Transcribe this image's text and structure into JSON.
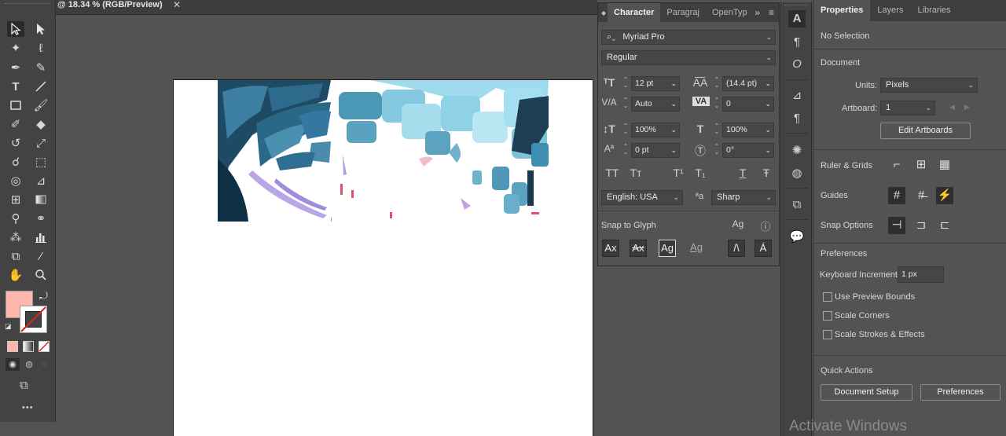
{
  "document": {
    "tab_title": "@ 18.34 % (RGB/Preview)",
    "close_glyph": "✕"
  },
  "toolbar": {
    "tools": [
      "selection-tool",
      "direct-selection-tool",
      "magic-wand-tool",
      "lasso-tool",
      "pen-tool",
      "curvature-tool",
      "type-tool",
      "line-tool",
      "rectangle-tool",
      "paintbrush-tool",
      "shaper-tool",
      "eraser-tool",
      "rotate-tool",
      "scale-tool",
      "warp-tool",
      "free-transform-tool",
      "shape-builder-tool",
      "perspective-grid-tool",
      "mesh-tool",
      "gradient-tool",
      "eyedropper-tool",
      "blend-tool",
      "symbol-sprayer-tool",
      "column-graph-tool",
      "artboard-tool",
      "slice-tool",
      "hand-tool",
      "zoom-tool"
    ],
    "fill_color": "#ffb6ad",
    "more_glyph": "•••"
  },
  "character_panel": {
    "tabs": [
      "Character",
      "Paragraph",
      "OpenType"
    ],
    "tab_labels_visible": [
      "Character",
      "Paragraj",
      "OpenTyp"
    ],
    "font_family": "Myriad Pro",
    "font_style": "Regular",
    "font_size": "12 pt",
    "leading": "(14.4 pt)",
    "kerning": "Auto",
    "tracking": "0",
    "vertical_scale": "100%",
    "horizontal_scale": "100%",
    "baseline_shift": "0 pt",
    "rotation": "0°",
    "language": "English: USA",
    "antialias": "Sharp",
    "snap_to_glyph_label": "Snap to Glyph",
    "text_style_buttons": [
      "TT",
      "Tт",
      "T¹",
      "T₁",
      "T",
      "Ŧ"
    ],
    "aa_glyph": "ªa"
  },
  "properties_panel": {
    "tabs": [
      "Properties",
      "Layers",
      "Libraries"
    ],
    "selection": "No Selection",
    "document_heading": "Document",
    "units_label": "Units:",
    "units_value": "Pixels",
    "artboard_label": "Artboard:",
    "artboard_value": "1",
    "edit_artboards": "Edit Artboards",
    "ruler_grids": "Ruler & Grids",
    "guides": "Guides",
    "snap_options": "Snap Options",
    "preferences_heading": "Preferences",
    "keyboard_increment_label": "Keyboard Increment:",
    "keyboard_increment_value": "1 px",
    "checkboxes": [
      "Use Preview Bounds",
      "Scale Corners",
      "Scale Strokes & Effects"
    ],
    "quick_actions": "Quick Actions",
    "document_setup": "Document Setup",
    "preferences_button": "Preferences"
  },
  "watermark": "Activate Windows"
}
